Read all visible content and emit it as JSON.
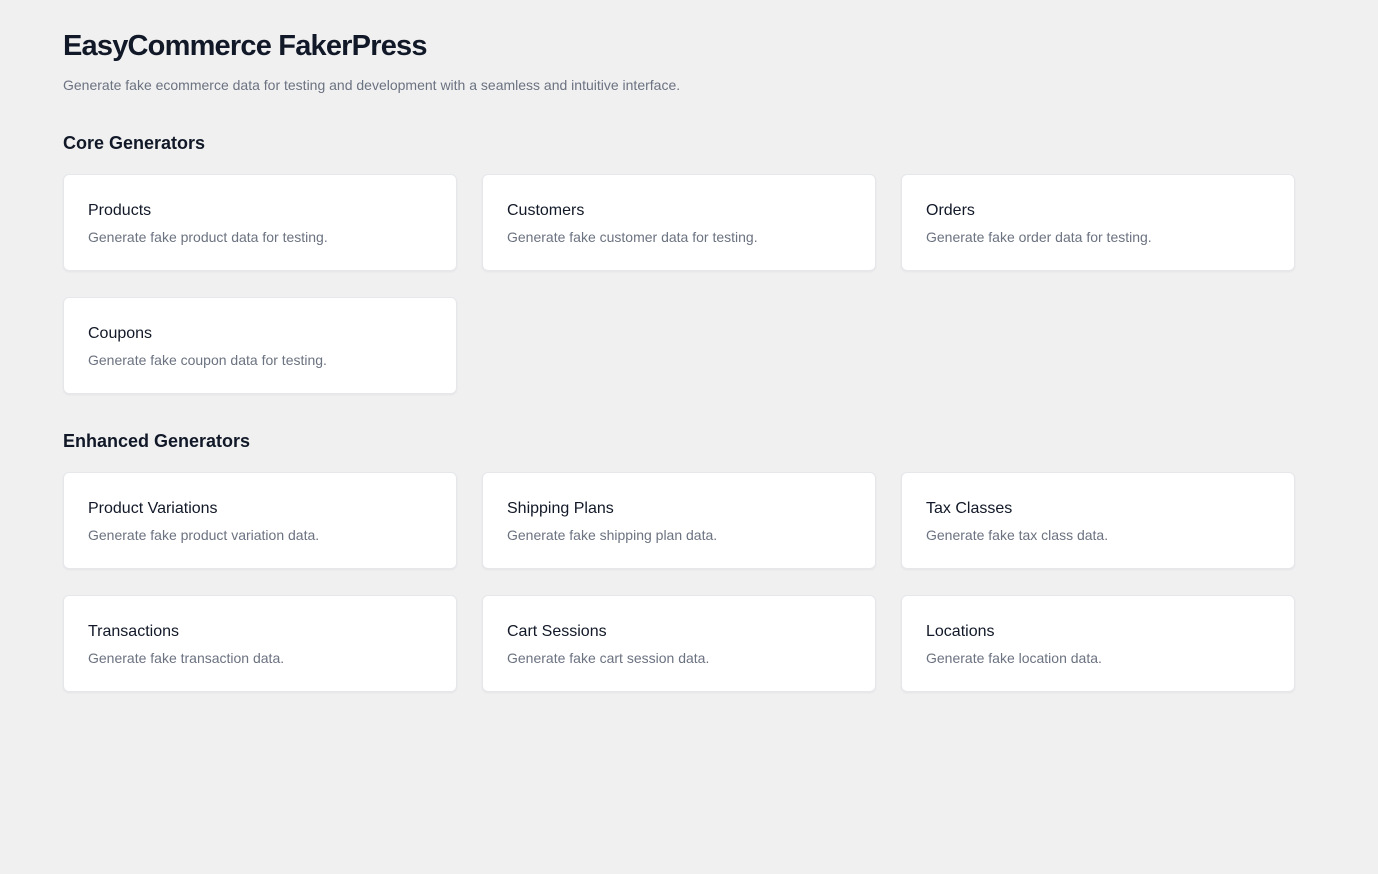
{
  "header": {
    "title": "EasyCommerce FakerPress",
    "subtitle": "Generate fake ecommerce data for testing and development with a seamless and intuitive interface."
  },
  "core": {
    "heading": "Core Generators",
    "items": [
      {
        "title": "Products",
        "desc": "Generate fake product data for testing."
      },
      {
        "title": "Customers",
        "desc": "Generate fake customer data for testing."
      },
      {
        "title": "Orders",
        "desc": "Generate fake order data for testing."
      },
      {
        "title": "Coupons",
        "desc": "Generate fake coupon data for testing."
      }
    ]
  },
  "enhanced": {
    "heading": "Enhanced Generators",
    "items": [
      {
        "title": "Product Variations",
        "desc": "Generate fake product variation data."
      },
      {
        "title": "Shipping Plans",
        "desc": "Generate fake shipping plan data."
      },
      {
        "title": "Tax Classes",
        "desc": "Generate fake tax class data."
      },
      {
        "title": "Transactions",
        "desc": "Generate fake transaction data."
      },
      {
        "title": "Cart Sessions",
        "desc": "Generate fake cart session data."
      },
      {
        "title": "Locations",
        "desc": "Generate fake location data."
      }
    ]
  }
}
